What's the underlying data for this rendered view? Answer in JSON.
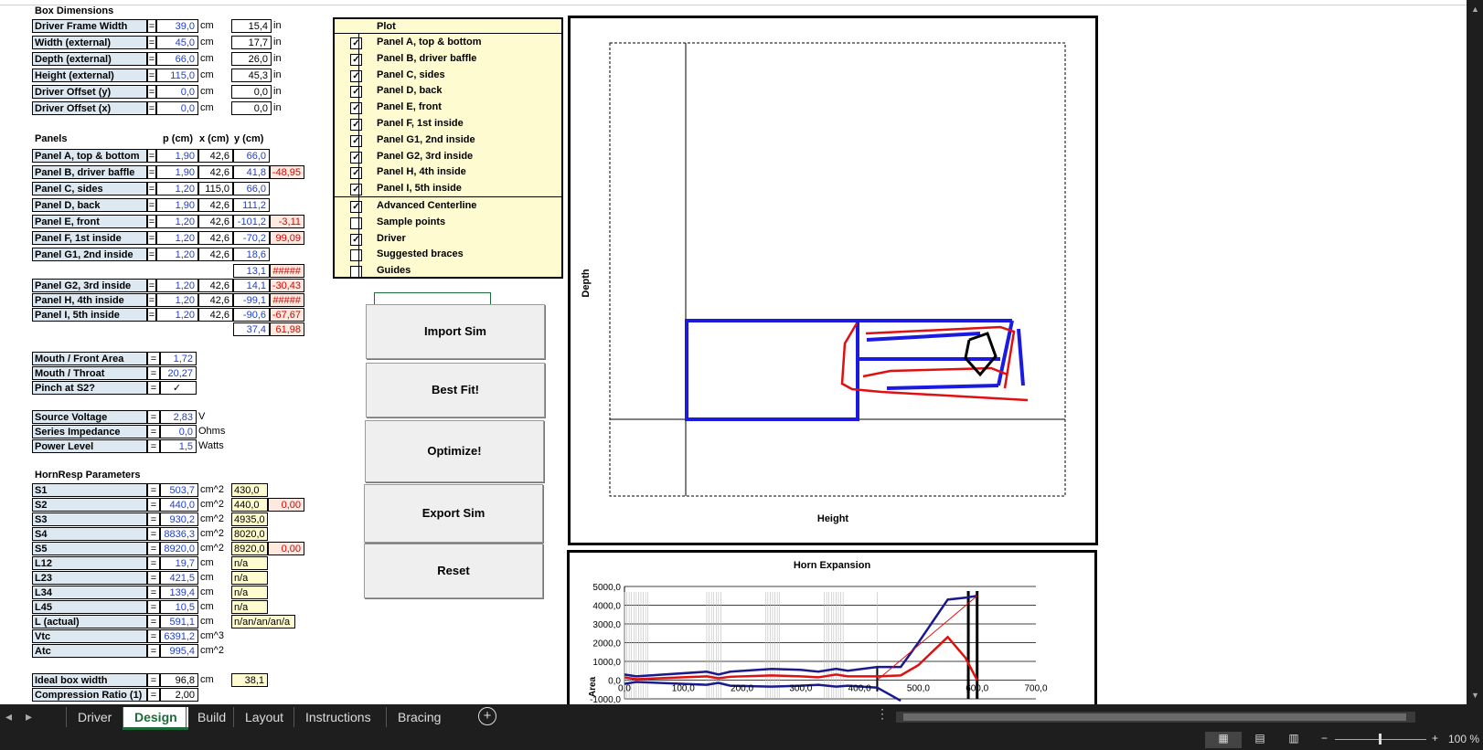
{
  "box": {
    "title": "Box Dimensions",
    "rows": [
      {
        "label": "Driver Frame Width",
        "eq": "=",
        "cm": "39,0",
        "u1": "cm",
        "inch": "15,4",
        "u2": "in"
      },
      {
        "label": "Width (external)",
        "eq": "=",
        "cm": "45,0",
        "u1": "cm",
        "inch": "17,7",
        "u2": "in"
      },
      {
        "label": "Depth (external)",
        "eq": "=",
        "cm": "66,0",
        "u1": "cm",
        "inch": "26,0",
        "u2": "in"
      },
      {
        "label": "Height (external)",
        "eq": "=",
        "cm": "115,0",
        "u1": "cm",
        "inch": "45,3",
        "u2": "in"
      },
      {
        "label": "Driver Offset (y)",
        "eq": "=",
        "cm": "0,0",
        "u1": "cm",
        "inch": "0,0",
        "u2": "in"
      },
      {
        "label": "Driver Offset (x)",
        "eq": "=",
        "cm": "0,0",
        "u1": "cm",
        "inch": "0,0",
        "u2": "in"
      }
    ]
  },
  "panels": {
    "title": "Panels",
    "col_p": "p (cm)",
    "col_x": "x (cm)",
    "col_y": "y (cm)",
    "rows": [
      {
        "label": "Panel A, top & bottom",
        "p": "1,90",
        "x": "42,6",
        "y": "66,0",
        "d": ""
      },
      {
        "label": "Panel B, driver baffle",
        "p": "1,90",
        "x": "42,6",
        "y": "41,8",
        "d": "-48,95"
      },
      {
        "label": "Panel C, sides",
        "p": "1,20",
        "x": "115,0",
        "y": "66,0",
        "d": ""
      },
      {
        "label": "Panel D, back",
        "p": "1,90",
        "x": "42,6",
        "y": "111,2",
        "d": ""
      },
      {
        "label": "Panel E, front",
        "p": "1,20",
        "x": "42,6",
        "y": "-101,2",
        "d": "-3,11"
      },
      {
        "label": "Panel F, 1st inside",
        "p": "1,20",
        "x": "42,6",
        "y": "-70,2",
        "d": "99,09"
      },
      {
        "label": "Panel G1, 2nd inside",
        "p": "1,20",
        "x": "42,6",
        "y": "18,6",
        "d": ""
      }
    ],
    "extra1": {
      "y": "13,1",
      "d": "#####"
    },
    "rows2": [
      {
        "label": "Panel G2, 3rd inside",
        "p": "1,20",
        "x": "42,6",
        "y": "14,1",
        "d": "-30,43"
      },
      {
        "label": "Panel H, 4th inside",
        "p": "1,20",
        "x": "42,6",
        "y": "-99,1",
        "d": "#####"
      },
      {
        "label": "Panel I, 5th inside",
        "p": "1,20",
        "x": "42,6",
        "y": "-90,6",
        "d": "-67,67"
      }
    ],
    "extra2": {
      "y": "37,4",
      "d": "61,98"
    }
  },
  "mouth": [
    {
      "label": "Mouth / Front Area",
      "eq": "=",
      "val": "1,72"
    },
    {
      "label": "Mouth / Throat",
      "eq": "=",
      "val": "20,27"
    },
    {
      "label": "Pinch at S2?",
      "eq": "=",
      "val": "✓"
    }
  ],
  "source": [
    {
      "label": "Source Voltage",
      "eq": "=",
      "val": "2,83",
      "unit": "V"
    },
    {
      "label": "Series Impedance",
      "eq": "=",
      "val": "0,0",
      "unit": "Ohms"
    },
    {
      "label": "Power Level",
      "eq": "=",
      "val": "1,5",
      "unit": "Watts"
    }
  ],
  "hornresp": {
    "title": "HornResp Parameters",
    "rows": [
      {
        "label": "S1",
        "eq": "=",
        "val": "503,7",
        "unit": "cm^2",
        "y": "430,0",
        "r": ""
      },
      {
        "label": "S2",
        "eq": "=",
        "val": "440,0",
        "unit": "cm^2",
        "y": "440,0",
        "r": "0,00"
      },
      {
        "label": "S3",
        "eq": "=",
        "val": "930,2",
        "unit": "cm^2",
        "y": "4935,0",
        "r": ""
      },
      {
        "label": "S4",
        "eq": "=",
        "val": "8836,3",
        "unit": "cm^2",
        "y": "8020,0",
        "r": ""
      },
      {
        "label": "S5",
        "eq": "=",
        "val": "8920,0",
        "unit": "cm^2",
        "y": "8920,0",
        "r": "0,00"
      },
      {
        "label": "L12",
        "eq": "=",
        "val": "19,7",
        "unit": "cm",
        "y": "n/a",
        "r": ""
      },
      {
        "label": "L23",
        "eq": "=",
        "val": "421,5",
        "unit": "cm",
        "y": "n/a",
        "r": ""
      },
      {
        "label": "L34",
        "eq": "=",
        "val": "139,4",
        "unit": "cm",
        "y": "n/a",
        "r": ""
      },
      {
        "label": "L45",
        "eq": "=",
        "val": "10,5",
        "unit": "cm",
        "y": "n/a",
        "r": ""
      },
      {
        "label": "L (actual)",
        "eq": "=",
        "val": "591,1",
        "unit": "cm",
        "y": "n/an/an/an/a",
        "r": ""
      },
      {
        "label": "Vtc",
        "eq": "=",
        "val": "6391,2",
        "unit": "cm^3",
        "y": "",
        "r": ""
      },
      {
        "label": "Atc",
        "eq": "=",
        "val": "995,4",
        "unit": "cm^2",
        "y": "",
        "r": ""
      }
    ]
  },
  "ideal": [
    {
      "label": "Ideal box width",
      "eq": "=",
      "val": "96,8",
      "unit": "cm",
      "extra": "38,1"
    },
    {
      "label": "Compression Ratio (1)",
      "eq": "=",
      "val": "2,00",
      "unit": "",
      "extra": ""
    }
  ],
  "plot": {
    "title": "Plot",
    "items": [
      {
        "label": "Panel A, top & bottom",
        "checked": "✓"
      },
      {
        "label": "Panel B, driver baffle",
        "checked": "✓"
      },
      {
        "label": "Panel C, sides",
        "checked": "✓"
      },
      {
        "label": "Panel D, back",
        "checked": "✓"
      },
      {
        "label": "Panel E, front",
        "checked": "✓"
      },
      {
        "label": "Panel F, 1st inside",
        "checked": "✓"
      },
      {
        "label": "Panel G1, 2nd inside",
        "checked": "✓"
      },
      {
        "label": "Panel G2, 3rd inside",
        "checked": "✓"
      },
      {
        "label": "Panel H, 4th inside",
        "checked": "✓"
      },
      {
        "label": "Panel I, 5th inside",
        "checked": "✓"
      }
    ],
    "items2": [
      {
        "label": "Advanced Centerline",
        "checked": "✓"
      },
      {
        "label": "Sample points",
        "checked": ""
      },
      {
        "label": "Driver",
        "checked": "✓"
      },
      {
        "label": "Suggested braces",
        "checked": ""
      },
      {
        "label": "Guides",
        "checked": ""
      }
    ]
  },
  "buttons": {
    "import": "Import Sim",
    "bestfit": "Best Fit!",
    "optimize": "Optimize!",
    "export": "Export Sim",
    "reset": "Reset"
  },
  "layout_chart": {
    "xlabel": "Height",
    "ylabel": "Depth"
  },
  "chart_data": {
    "type": "line",
    "title": "Horn Expansion",
    "ylabel": "Area",
    "xlabel": "",
    "xlim": [
      0,
      700
    ],
    "ylim": [
      -1000,
      5000
    ],
    "x_ticks": [
      "0,0",
      "100,0",
      "200,0",
      "300,0",
      "400,0",
      "500,0",
      "600,0",
      "700,0"
    ],
    "y_ticks": [
      "5000,0",
      "4000,0",
      "3000,0",
      "2000,0",
      "1000,0",
      "0,0",
      "-1000,0"
    ],
    "grid": true,
    "series": [
      {
        "color": "#1a1a8c",
        "x": [
          0,
          20,
          140,
          160,
          180,
          250,
          300,
          330,
          360,
          380,
          430,
          470,
          500,
          550,
          580,
          600
        ],
        "y": [
          300,
          200,
          450,
          300,
          450,
          600,
          550,
          450,
          600,
          500,
          700,
          700,
          2000,
          4300,
          4400,
          4500
        ]
      },
      {
        "color": "#e01010",
        "x": [
          0,
          20,
          140,
          160,
          180,
          250,
          300,
          330,
          360,
          380,
          430,
          470,
          500,
          550,
          580,
          600
        ],
        "y": [
          150,
          50,
          200,
          100,
          180,
          250,
          200,
          150,
          300,
          200,
          200,
          250,
          800,
          2300,
          1200,
          0
        ]
      },
      {
        "color": "#e01010",
        "x": [
          430,
          600
        ],
        "y": [
          0,
          4500
        ]
      },
      {
        "color": "#1a1a8c",
        "x": [
          0,
          20,
          140,
          160,
          180,
          250,
          300,
          330,
          360,
          380,
          430,
          470
        ],
        "y": [
          -200,
          -100,
          -250,
          -150,
          -300,
          -350,
          -300,
          -250,
          -350,
          -300,
          -400,
          -1100
        ]
      }
    ]
  },
  "tabs": [
    "Driver",
    "Design",
    "Build",
    "Layout",
    "Instructions",
    "Bracing"
  ],
  "active_tab": "Design",
  "zoom": "100 %"
}
